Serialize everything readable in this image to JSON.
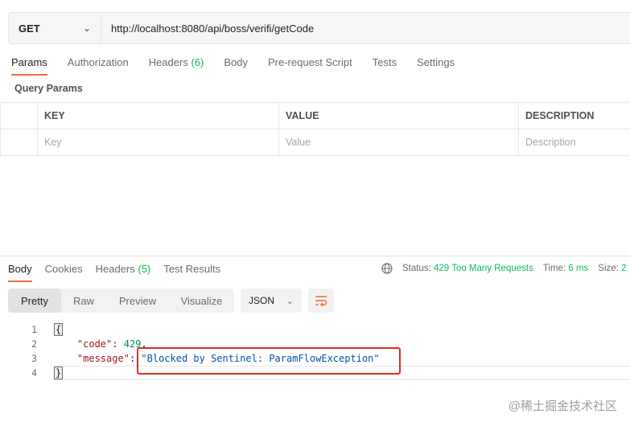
{
  "request": {
    "method": "GET",
    "url": "http://localhost:8080/api/boss/verifi/getCode"
  },
  "request_tabs": [
    {
      "label": "Params",
      "active": true
    },
    {
      "label": "Authorization"
    },
    {
      "label": "Headers",
      "count": "(6)"
    },
    {
      "label": "Body"
    },
    {
      "label": "Pre-request Script"
    },
    {
      "label": "Tests"
    },
    {
      "label": "Settings"
    }
  ],
  "query_params": {
    "title": "Query Params",
    "columns": [
      "KEY",
      "VALUE",
      "DESCRIPTION"
    ],
    "placeholders": [
      "Key",
      "Value",
      "Description"
    ]
  },
  "response_tabs": [
    {
      "label": "Body",
      "active": true
    },
    {
      "label": "Cookies"
    },
    {
      "label": "Headers",
      "count": "(5)"
    },
    {
      "label": "Test Results"
    }
  ],
  "response_status": {
    "status_label": "Status:",
    "status_value": "429 Too Many Requests",
    "time_label": "Time:",
    "time_value": "6 ms",
    "size_label": "Size:",
    "size_value": "2"
  },
  "view_modes": [
    "Pretty",
    "Raw",
    "Preview",
    "Visualize"
  ],
  "active_view": "Pretty",
  "format": "JSON",
  "code_lines": {
    "l1": {
      "num": "1",
      "open": "{"
    },
    "l2": {
      "num": "2",
      "key": "\"code\"",
      "sep": ": ",
      "value": "429",
      "tail": ","
    },
    "l3": {
      "num": "3",
      "key": "\"message\"",
      "sep": ": ",
      "value": "\"Blocked by Sentinel: ParamFlowException\""
    },
    "l4": {
      "num": "4",
      "close": "}"
    }
  },
  "watermark": "@稀土掘金技术社区",
  "colors": {
    "accent": "#f26b3a",
    "success": "#0cbb52",
    "highlight": "#e02b25"
  }
}
